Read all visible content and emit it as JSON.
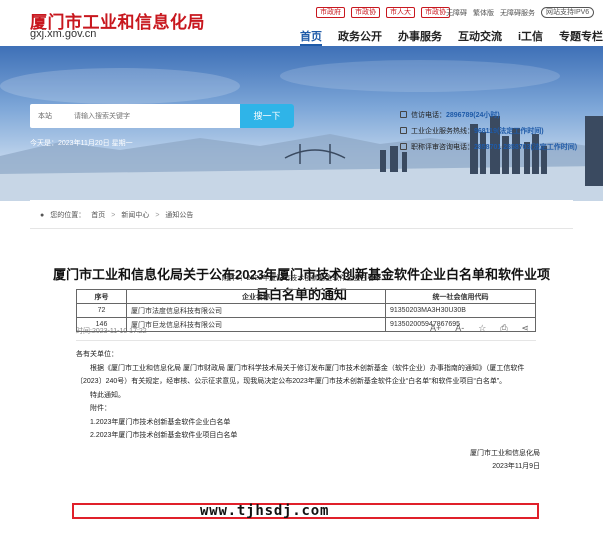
{
  "header": {
    "title": "厦门市工业和信息化局",
    "domain": "gxj.xm.gov.cn",
    "top_links": [
      "市政府",
      "市政协",
      "市人大",
      "市政协"
    ],
    "accessibility": [
      "无障碍",
      "繁体版",
      "无障碍服务"
    ],
    "ipv6": "网站支持IPV6",
    "nav": [
      {
        "label": "首页",
        "active": true
      },
      {
        "label": "政务公开",
        "active": false
      },
      {
        "label": "办事服务",
        "active": false
      },
      {
        "label": "互动交流",
        "active": false
      },
      {
        "label": "i工信",
        "active": false
      },
      {
        "label": "专题专栏",
        "active": false
      }
    ]
  },
  "banner": {
    "scope": "本站",
    "search_placeholder": "请输入搜索关键字",
    "search_button": "搜一下",
    "today": "今天是：2023年11月20日 星期一",
    "hotlines": [
      {
        "label": "信访电话：",
        "value": "2896789(24小时)"
      },
      {
        "label": "工业企业服务热线：",
        "value": "968119(法定工作时间)"
      },
      {
        "label": "职称评审咨询电话：",
        "value": "2858701 2858703(法定工作时间)"
      }
    ]
  },
  "breadcrumb": {
    "label": "您的位置：",
    "items": [
      "首页",
      "新闻中心",
      "通知公告"
    ],
    "sep": ">"
  },
  "article": {
    "title": "厦门市工业和信息化局关于公布2023年厦门市技术创新基金软件企业白名单和软件业项目白名单的通知",
    "meta": "时间:2023-11-10 17:22",
    "tools": [
      "A+",
      "A-",
      "☆",
      "⎙",
      "⋖"
    ],
    "salutation": "各有关单位：",
    "paragraph": "根据《厦门市工业和信息化局 厦门市财政局 厦门市科学技术局关于修订发布厦门市技术创新基金（软件企业）办事指南的通知》（厦工信软件〔2023〕240号）有关规定，经审核、公示征求意见，现我局决定公布2023年厦门市技术创新基金软件企业“白名单”和软件业项目“白名单”。",
    "special": "特此通知。",
    "attachments_label": "附件：",
    "attachments": [
      "1.2023年厦门市技术创新基金软件企业白名单",
      "2.2023年厦门市技术创新基金软件业项目白名单"
    ],
    "sign_org": "厦门市工业和信息化局",
    "sign_date": "2023年11月9日",
    "attachment_title": "附件1：2023年厦门市技术创新基金软件企业白名单"
  },
  "table": {
    "headers": [
      "序号",
      "企业名称",
      "统一社会信用代码"
    ],
    "rows": [
      [
        "72",
        "厦门市法度信息科技有限公司",
        "91350203MA3H30U30B"
      ],
      [
        "146",
        "厦门市巨龙信息科技有限公司",
        "913502005947867695"
      ]
    ]
  },
  "watermark": "www.tjhsdj.com",
  "colors": {
    "brand_red": "#c8171e",
    "nav_blue": "#1e5aa8",
    "search_btn": "#2fb4e8",
    "highlight": "#e0202a"
  }
}
